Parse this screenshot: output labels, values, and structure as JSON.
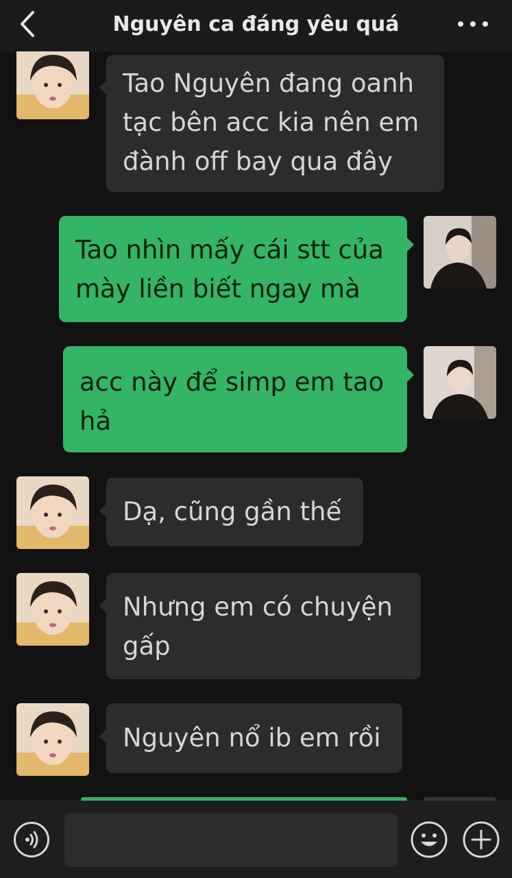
{
  "header": {
    "title": "Nguyên ca đáng yêu quá",
    "back_icon": "chevron-left-icon",
    "more_icon": "more-dots-icon"
  },
  "messages": [
    {
      "side": "in",
      "text": "Tao Nguyên đang oanh tạc bên acc kia nên em đành off bay qua đây"
    },
    {
      "side": "out",
      "text": "Tao nhìn mấy cái stt của mày liền biết ngay mà"
    },
    {
      "side": "out",
      "text": "acc này để simp em tao hả"
    },
    {
      "side": "in",
      "text": "Dạ, cũng gần thế"
    },
    {
      "side": "in",
      "text": "Nhưng em có chuyện gấp"
    },
    {
      "side": "in",
      "text": "Nguyên nổ ib em rồi"
    }
  ],
  "input_bar": {
    "placeholder": "",
    "voice_icon": "voice-icon",
    "emoji_icon": "emoji-icon",
    "plus_icon": "plus-icon"
  },
  "colors": {
    "incoming_bubble": "#2c2c2c",
    "outgoing_bubble": "#33b565",
    "background": "#121212"
  }
}
